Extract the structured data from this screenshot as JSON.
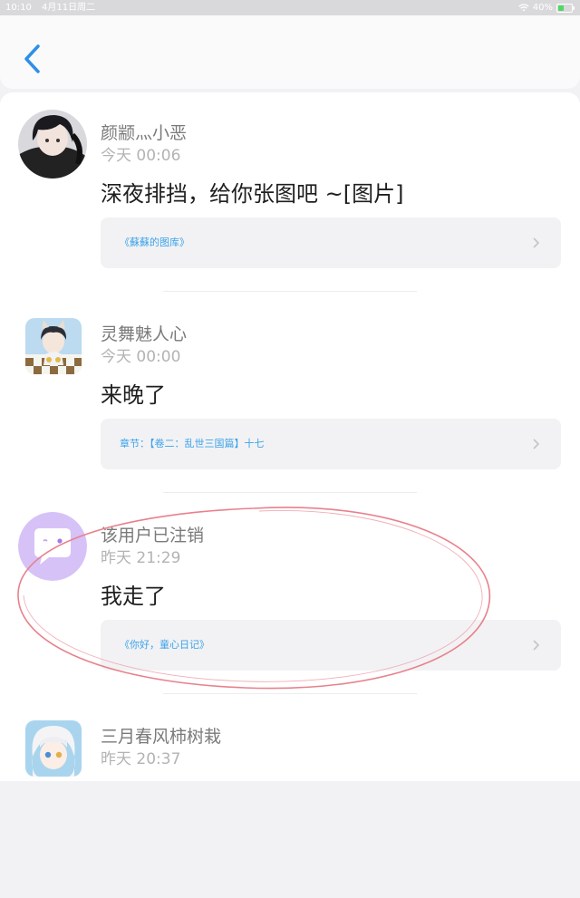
{
  "status_bar": {
    "time": "10:10",
    "date": "4月11日周二",
    "battery": "40%",
    "battery_level": 0.4
  },
  "nav": {
    "back_icon": "chevron-left-icon"
  },
  "posts": [
    {
      "username": "颜颛灬小恶",
      "time": "今天 00:06",
      "message": "深夜排挡，给你张图吧 ~[图片]",
      "link": "《蘇蘇的图库》"
    },
    {
      "username": "灵舞魅人心",
      "time": "今天 00:00",
      "message": "来晚了",
      "link": "章节：【卷二：乱世三国篇】十七"
    },
    {
      "username": "该用户已注销",
      "time": "昨天 21:29",
      "message": "我走了",
      "link": "《你好，童心日记》"
    },
    {
      "username": "三月春风柿树栽",
      "time": "昨天 20:37"
    }
  ],
  "colors": {
    "accent": "#2f8fe8",
    "link": "#3ba2ea",
    "annotation": "#e8818c",
    "deleted_avatar": "#cdb4f5"
  }
}
